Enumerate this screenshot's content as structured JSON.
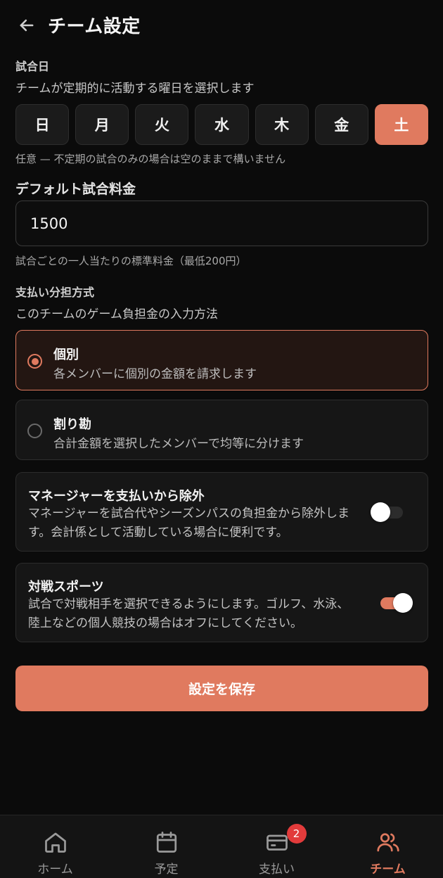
{
  "header": {
    "title": "チーム設定"
  },
  "match_day": {
    "label": "試合日",
    "description": "チームが定期的に活動する曜日を選択します",
    "days": [
      "日",
      "月",
      "火",
      "水",
      "木",
      "金",
      "土"
    ],
    "selected": "土",
    "help": "任意 — 不定期の試合のみの場合は空のままで構いません"
  },
  "fee": {
    "label": "デフォルト試合料金",
    "value": "1500",
    "help": "試合ごとの一人当たりの標準料金（最低200円）"
  },
  "payment_split": {
    "label": "支払い分担方式",
    "description": "このチームのゲーム負担金の入力方法",
    "options": [
      {
        "title": "個別",
        "desc": "各メンバーに個別の金額を請求します",
        "selected": true
      },
      {
        "title": "割り勘",
        "desc": "合計金額を選択したメンバーで均等に分けます",
        "selected": false
      }
    ]
  },
  "toggles": {
    "exclude_manager": {
      "title": "マネージャーを支払いから除外",
      "desc": "マネージャーを試合代やシーズンパスの負担金から除外します。会計係として活動している場合に便利です。",
      "on": false
    },
    "versus_sport": {
      "title": "対戦スポーツ",
      "desc": "試合で対戦相手を選択できるようにします。ゴルフ、水泳、陸上などの個人競技の場合はオフにしてください。",
      "on": true
    }
  },
  "save_label": "設定を保存",
  "tabs": [
    {
      "label": "ホーム",
      "icon": "home-icon"
    },
    {
      "label": "予定",
      "icon": "calendar-icon"
    },
    {
      "label": "支払い",
      "icon": "credit-card-icon",
      "badge": "2"
    },
    {
      "label": "チーム",
      "icon": "users-icon",
      "active": true
    }
  ],
  "colors": {
    "accent": "#e07a5f",
    "background": "#0b0b0b",
    "badge": "#e23b3b"
  }
}
